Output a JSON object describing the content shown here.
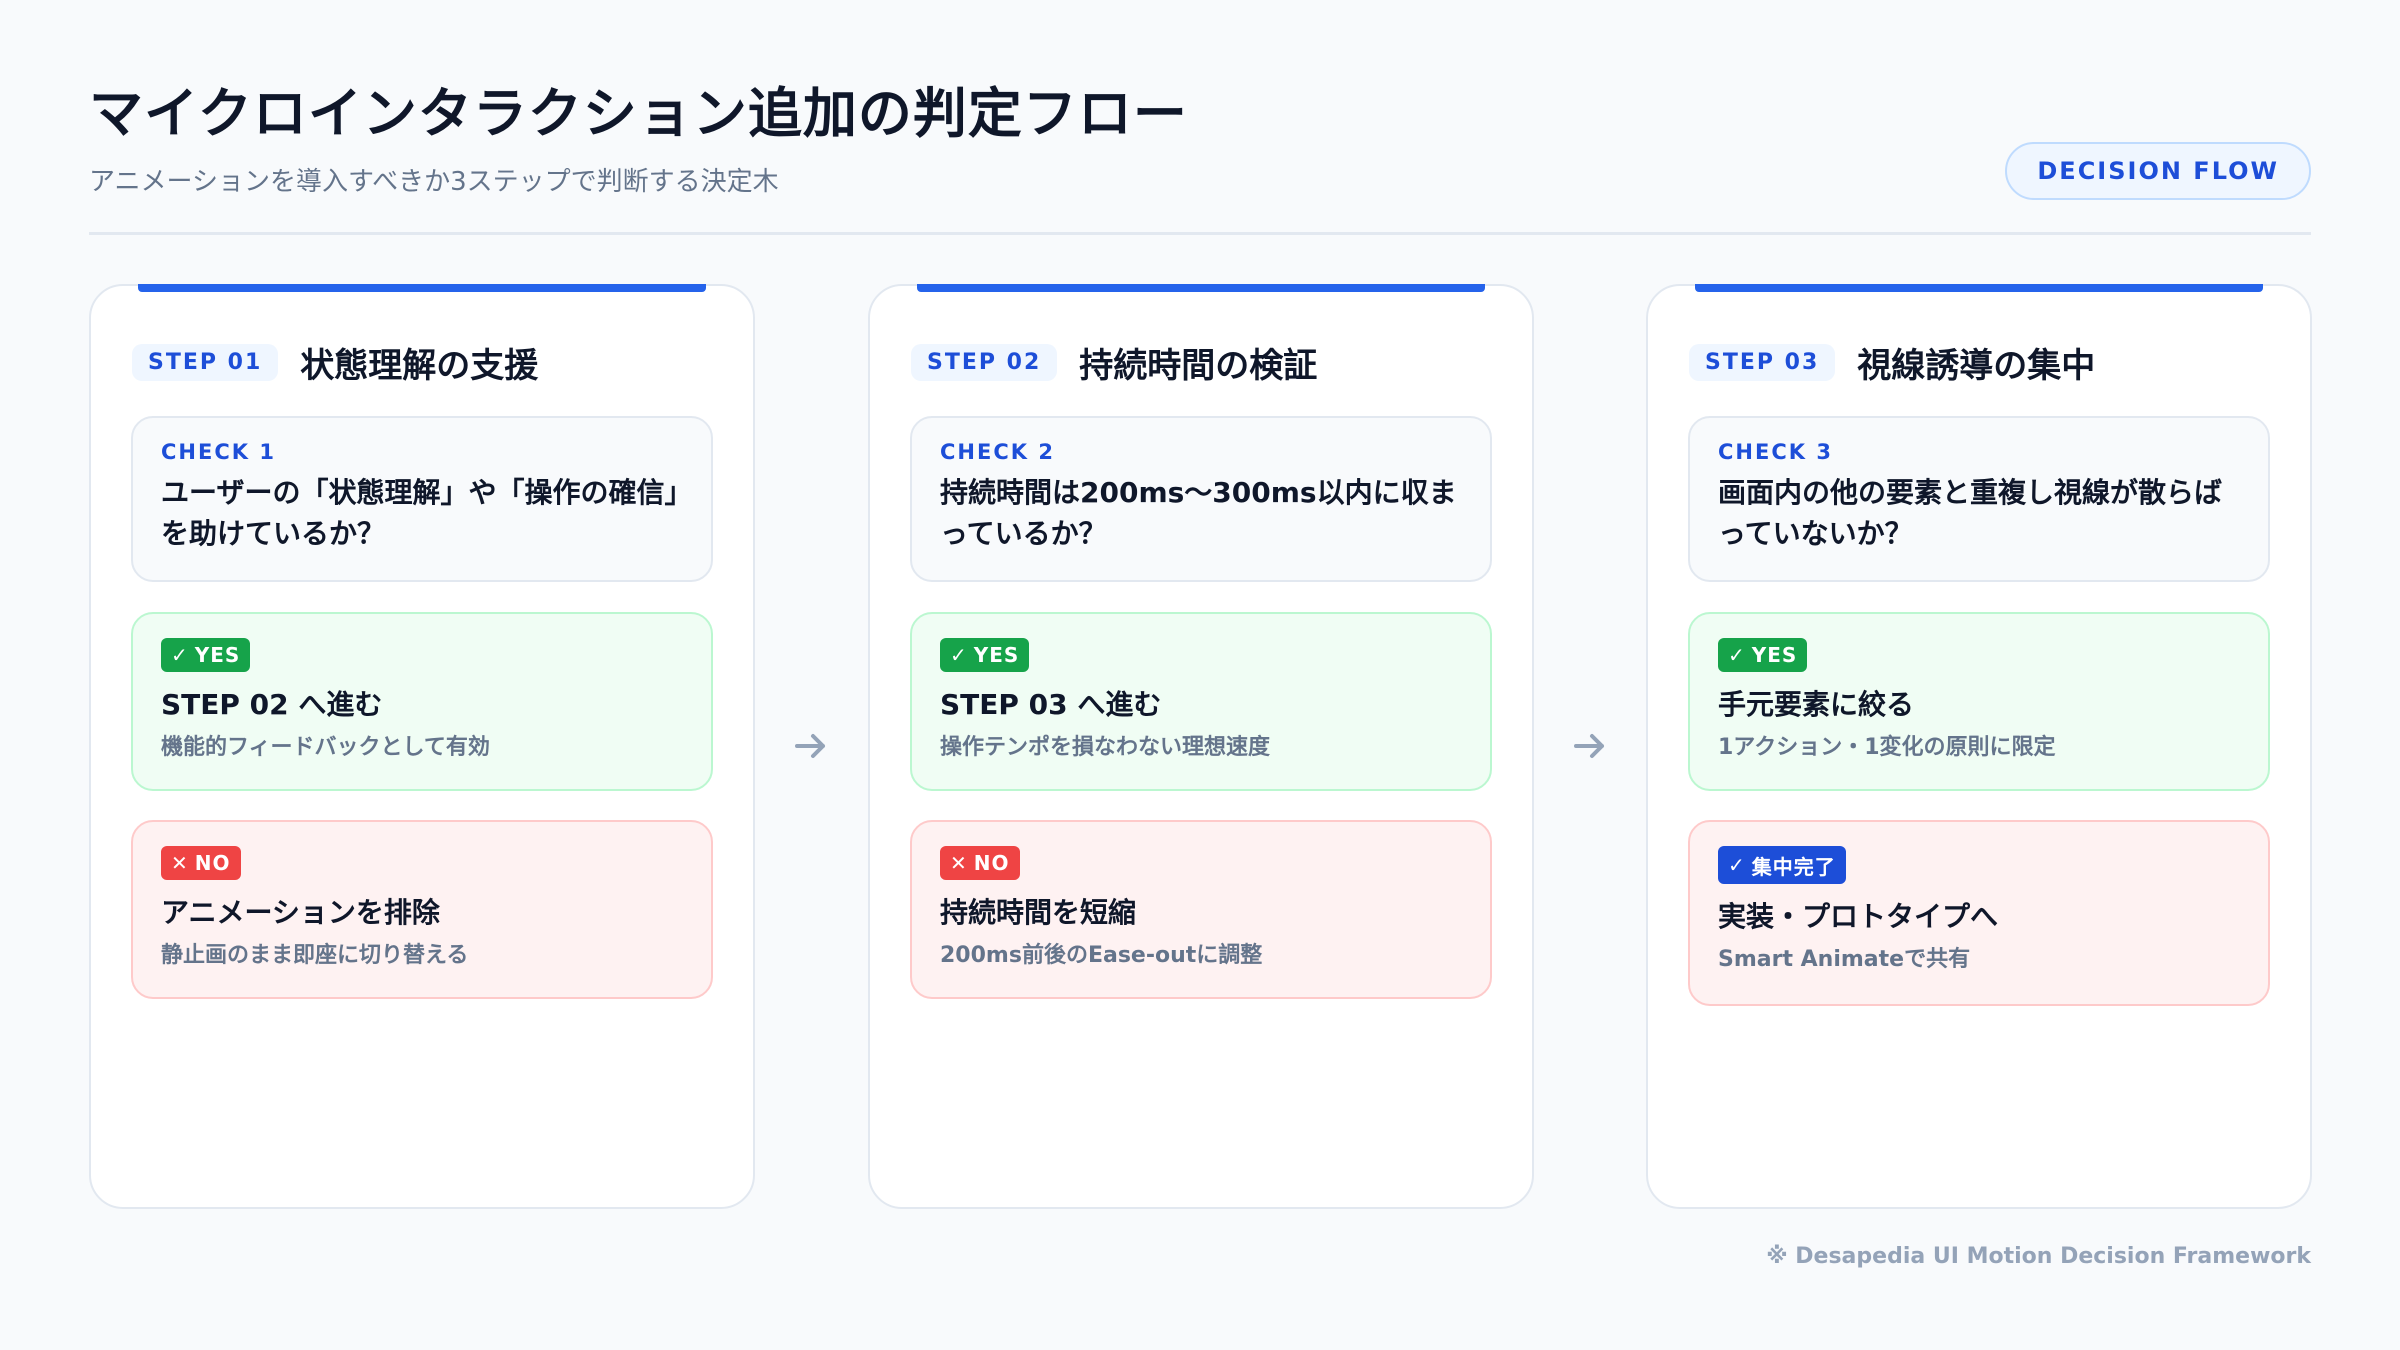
{
  "header": {
    "title": "マイクロインタラクション追加の判定フロー",
    "subtitle": "アニメーションを導入すべきか3ステップで判断する決定木",
    "badge": "DECISION FLOW"
  },
  "steps": [
    {
      "step_label": "STEP 01",
      "title": "状態理解の支援",
      "check_label": "CHECK 1",
      "question": "ユーザーの「状態理解」や「操作の確信」を助けているか？",
      "yes_tag": "YES",
      "yes_title": "STEP 02 へ進む",
      "yes_desc": "機能的フィードバックとして有効",
      "no_tag": "NO",
      "no_title": "アニメーションを排除",
      "no_desc": "静止画のまま即座に切り替える"
    },
    {
      "step_label": "STEP 02",
      "title": "持続時間の検証",
      "check_label": "CHECK 2",
      "question": "持続時間は200ms〜300ms以内に収まっているか？",
      "yes_tag": "YES",
      "yes_title": "STEP 03 へ進む",
      "yes_desc": "操作テンポを損なわない理想速度",
      "no_tag": "NO",
      "no_title": "持続時間を短縮",
      "no_desc": "200ms前後のEase-outに調整"
    },
    {
      "step_label": "STEP 03",
      "title": "視線誘導の集中",
      "check_label": "CHECK 3",
      "question": "画面内の他の要素と重複し視線が散らばっていないか？",
      "yes_tag": "YES",
      "yes_title": "手元要素に絞る",
      "yes_desc": "1アクション・1変化の原則に限定",
      "done_tag": "集中完了",
      "done_title": "実装・プロトタイプへ",
      "done_desc": "Smart Animateで共有"
    }
  ],
  "footer": "※ Desapedia UI Motion Decision Framework",
  "colors": {
    "accent": "#2563eb",
    "yes": "#16a34a",
    "no": "#ef4444",
    "done": "#1d4ed8"
  }
}
